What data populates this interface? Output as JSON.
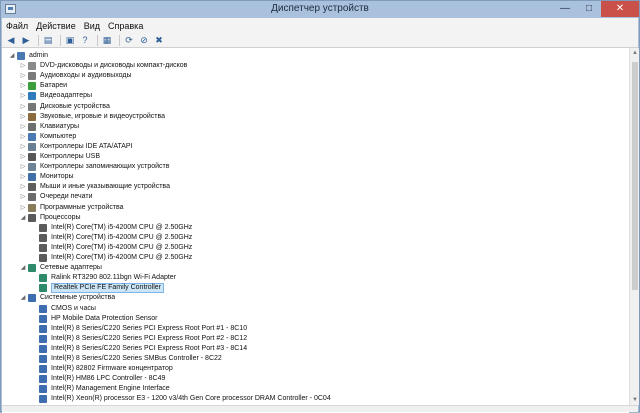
{
  "window": {
    "title": "Диспетчер устройств"
  },
  "controls": {
    "minimize": "—",
    "maximize": "□",
    "close": "✕"
  },
  "menu": [
    "Файл",
    "Действие",
    "Вид",
    "Справка"
  ],
  "toolbar": [
    "back-icon",
    "forward-icon",
    "separator",
    "properties-icon",
    "separator",
    "console-icon",
    "help-icon",
    "separator",
    "display-icon",
    "separator",
    "scan-icon",
    "disable-icon",
    "uninstall-icon"
  ],
  "tree": {
    "root": "admin",
    "items": [
      {
        "level": 0,
        "exp": "◢",
        "icon": "computer-icon",
        "label": "admin"
      },
      {
        "level": 1,
        "exp": "▷",
        "icon": "dvd-drive-icon",
        "label": "DVD-дисководы и дисководы компакт-дисков"
      },
      {
        "level": 1,
        "exp": "▷",
        "icon": "audio-icon",
        "label": "Аудиовходы и аудиовыходы"
      },
      {
        "level": 1,
        "exp": "▷",
        "icon": "battery-icon",
        "label": "Батареи"
      },
      {
        "level": 1,
        "exp": "▷",
        "icon": "display-adapter-icon",
        "label": "Видеоадаптеры"
      },
      {
        "level": 1,
        "exp": "▷",
        "icon": "disk-drive-icon",
        "label": "Дисковые устройства"
      },
      {
        "level": 1,
        "exp": "▷",
        "icon": "sound-icon",
        "label": "Звуковые, игровые и видеоустройства"
      },
      {
        "level": 1,
        "exp": "▷",
        "icon": "keyboard-icon",
        "label": "Клавиатуры"
      },
      {
        "level": 1,
        "exp": "▷",
        "icon": "computer-icon",
        "label": "Компьютер"
      },
      {
        "level": 1,
        "exp": "▷",
        "icon": "ide-icon",
        "label": "Контроллеры IDE ATA/ATAPI"
      },
      {
        "level": 1,
        "exp": "▷",
        "icon": "usb-icon",
        "label": "Контроллеры USB"
      },
      {
        "level": 1,
        "exp": "▷",
        "icon": "storage-icon",
        "label": "Контроллеры запоминающих устройств"
      },
      {
        "level": 1,
        "exp": "▷",
        "icon": "monitor-icon",
        "label": "Мониторы"
      },
      {
        "level": 1,
        "exp": "▷",
        "icon": "mouse-icon",
        "label": "Мыши и иные указывающие устройства"
      },
      {
        "level": 1,
        "exp": "▷",
        "icon": "printer-icon",
        "label": "Очереди печати"
      },
      {
        "level": 1,
        "exp": "▷",
        "icon": "software-icon",
        "label": "Программные устройства"
      },
      {
        "level": 1,
        "exp": "◢",
        "icon": "processor-icon",
        "label": "Процессоры"
      },
      {
        "level": 2,
        "exp": "",
        "icon": "processor-icon",
        "label": "Intel(R) Core(TM) i5-4200M CPU @ 2.50GHz"
      },
      {
        "level": 2,
        "exp": "",
        "icon": "processor-icon",
        "label": "Intel(R) Core(TM) i5-4200M CPU @ 2.50GHz"
      },
      {
        "level": 2,
        "exp": "",
        "icon": "processor-icon",
        "label": "Intel(R) Core(TM) i5-4200M CPU @ 2.50GHz"
      },
      {
        "level": 2,
        "exp": "",
        "icon": "processor-icon",
        "label": "Intel(R) Core(TM) i5-4200M CPU @ 2.50GHz"
      },
      {
        "level": 1,
        "exp": "◢",
        "icon": "network-icon",
        "label": "Сетевые адаптеры"
      },
      {
        "level": 2,
        "exp": "",
        "icon": "network-icon",
        "label": "Ralink RT3290 802.11bgn Wi-Fi Adapter"
      },
      {
        "level": 2,
        "exp": "",
        "icon": "network-icon",
        "label": "Realtek PCIe FE Family Controller",
        "selected": true
      },
      {
        "level": 1,
        "exp": "◢",
        "icon": "system-device-icon",
        "label": "Системные устройства"
      },
      {
        "level": 2,
        "exp": "",
        "icon": "system-device-icon",
        "label": "CMOS и часы"
      },
      {
        "level": 2,
        "exp": "",
        "icon": "system-device-icon",
        "label": "HP Mobile Data Protection Sensor"
      },
      {
        "level": 2,
        "exp": "",
        "icon": "system-device-icon",
        "label": "Intel(R) 8 Series/C220 Series PCI Express Root Port #1 - 8C10"
      },
      {
        "level": 2,
        "exp": "",
        "icon": "system-device-icon",
        "label": "Intel(R) 8 Series/C220 Series PCI Express Root Port #2 - 8C12"
      },
      {
        "level": 2,
        "exp": "",
        "icon": "system-device-icon",
        "label": "Intel(R) 8 Series/C220 Series PCI Express Root Port #3 - 8C14"
      },
      {
        "level": 2,
        "exp": "",
        "icon": "system-device-icon",
        "label": "Intel(R) 8 Series/C220 Series SMBus Controller - 8C22"
      },
      {
        "level": 2,
        "exp": "",
        "icon": "system-device-icon",
        "label": "Intel(R) 82802 Firmware концентратор"
      },
      {
        "level": 2,
        "exp": "",
        "icon": "system-device-icon",
        "label": "Intel(R) HM86 LPC Controller - 8C49"
      },
      {
        "level": 2,
        "exp": "",
        "icon": "system-device-icon",
        "label": "Intel(R) Management Engine Interface"
      },
      {
        "level": 2,
        "exp": "",
        "icon": "system-device-icon",
        "label": "Intel(R) Xeon(R) processor E3 - 1200 v3/4th Gen Core processor DRAM Controller - 0C04"
      }
    ]
  },
  "icon_colors": {
    "computer-icon": "#4a78b0",
    "dvd-drive-icon": "#8a8a8a",
    "audio-icon": "#7a7a7a",
    "battery-icon": "#3c9d3c",
    "display-adapter-icon": "#2f7bbd",
    "disk-drive-icon": "#777777",
    "sound-icon": "#8d6a3c",
    "keyboard-icon": "#6f6f6f",
    "ide-icon": "#6a7f93",
    "usb-icon": "#565656",
    "storage-icon": "#6e8395",
    "monitor-icon": "#3f6fa8",
    "mouse-icon": "#5e5e5e",
    "printer-icon": "#6b6b6b",
    "software-icon": "#8a7b5a",
    "processor-icon": "#5b5b5b",
    "network-icon": "#2f8a6a",
    "system-device-icon": "#3e6eb0"
  }
}
